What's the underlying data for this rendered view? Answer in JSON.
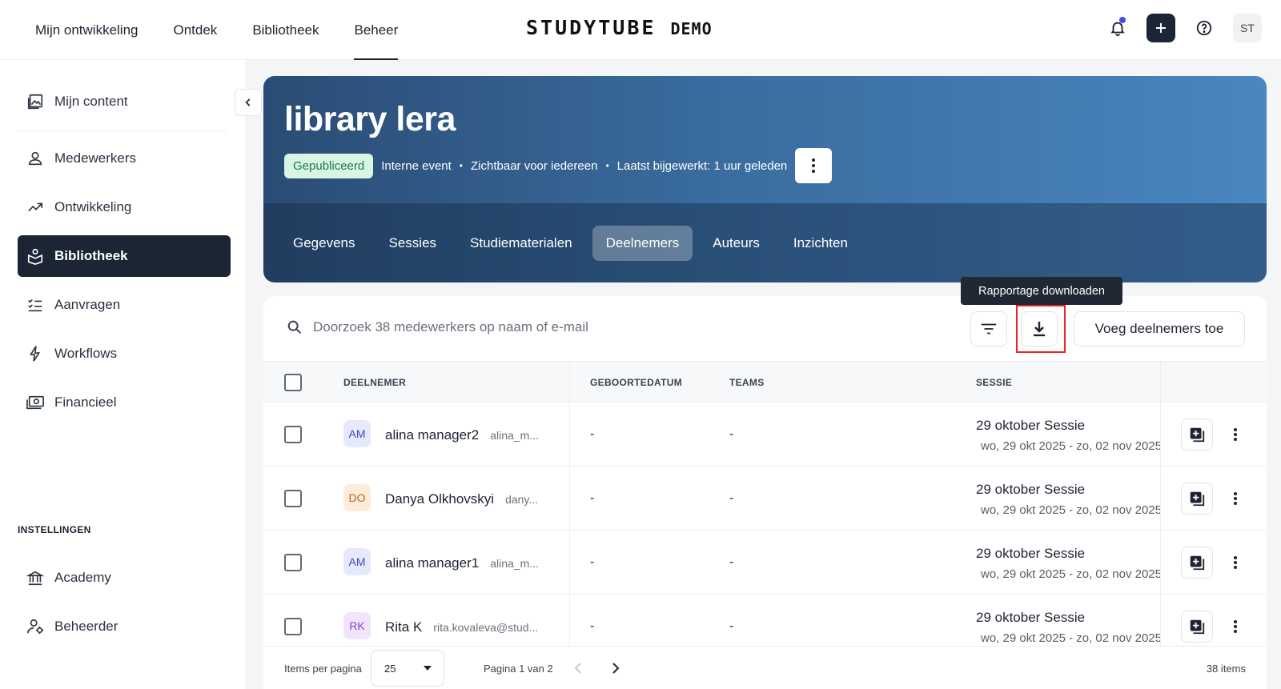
{
  "topnav": {
    "items": [
      {
        "label": "Mijn ontwikkeling"
      },
      {
        "label": "Ontdek"
      },
      {
        "label": "Bibliotheek"
      },
      {
        "label": "Beheer"
      }
    ],
    "active": "Beheer"
  },
  "logo": {
    "brand": "STUDYTUBE",
    "suffix": "DEMO"
  },
  "user": {
    "initials": "ST"
  },
  "sidebar": {
    "items": [
      {
        "label": "Mijn content",
        "icon": "images-icon"
      },
      {
        "label": "Medewerkers",
        "icon": "person-icon"
      },
      {
        "label": "Ontwikkeling",
        "icon": "trending-up-icon"
      },
      {
        "label": "Bibliotheek",
        "icon": "library-icon"
      },
      {
        "label": "Aanvragen",
        "icon": "checklist-icon"
      },
      {
        "label": "Workflows",
        "icon": "bolt-icon"
      },
      {
        "label": "Financieel",
        "icon": "money-icon"
      }
    ],
    "settings_heading": "INSTELLINGEN",
    "settings_items": [
      {
        "label": "Academy",
        "icon": "institution-icon"
      },
      {
        "label": "Beheerder",
        "icon": "admin-icon"
      }
    ]
  },
  "hero": {
    "title": "library lera",
    "status": "Gepubliceerd",
    "type": "Interne event",
    "visibility": "Zichtbaar voor iedereen",
    "updated": "Laatst bijgewerkt: 1 uur geleden",
    "tabs": [
      {
        "label": "Gegevens"
      },
      {
        "label": "Sessies"
      },
      {
        "label": "Studiematerialen"
      },
      {
        "label": "Deelnemers"
      },
      {
        "label": "Auteurs"
      },
      {
        "label": "Inzichten"
      }
    ],
    "active_tab": "Deelnemers"
  },
  "toolbar": {
    "search_placeholder": "Doorzoek 38 medewerkers op naam of e-mail",
    "tooltip": "Rapportage downloaden",
    "add_label": "Voeg deelnemers toe"
  },
  "table": {
    "columns": [
      "DEELNEMER",
      "GEBOORTEDATUM",
      "TEAMS",
      "SESSIE"
    ],
    "rows": [
      {
        "initials": "AM",
        "name": "alina manager2",
        "email": "alina_m...",
        "birthdate": "-",
        "teams": "-",
        "session": "29 oktober Sessie",
        "session_dates": "wo, 29 okt 2025 - zo, 02 nov 2025"
      },
      {
        "initials": "DO",
        "name": "Danya Olkhovskyi",
        "email": "dany...",
        "birthdate": "-",
        "teams": "-",
        "session": "29 oktober Sessie",
        "session_dates": "wo, 29 okt 2025 - zo, 02 nov 2025"
      },
      {
        "initials": "AM",
        "name": "alina manager1",
        "email": "alina_m...",
        "birthdate": "-",
        "teams": "-",
        "session": "29 oktober Sessie",
        "session_dates": "wo, 29 okt 2025 - zo, 02 nov 2025"
      },
      {
        "initials": "RK",
        "name": "Rita K",
        "email": "rita.kovaleva@stud...",
        "birthdate": "-",
        "teams": "-",
        "session": "29 oktober Sessie",
        "session_dates": "wo, 29 okt 2025 - zo, 02 nov 2025"
      }
    ]
  },
  "pagination": {
    "items_per_page_label": "Items per pagina",
    "items_per_page": "25",
    "page_info": "Pagina 1 van 2",
    "total": "38 items"
  },
  "colors": {
    "accent_dark": "#1b2533",
    "published_bg": "#d8f5e6",
    "published_text": "#1b7a45",
    "highlight": "#e22222"
  }
}
